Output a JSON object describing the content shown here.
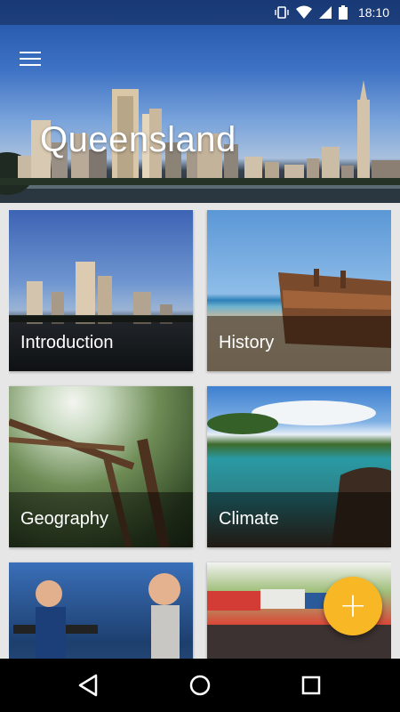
{
  "status_bar": {
    "time": "18:10",
    "icons": [
      "vibrate-icon",
      "wifi-icon",
      "signal-icon",
      "battery-icon"
    ]
  },
  "header": {
    "title": "Queensland",
    "menu_icon": "hamburger-menu-icon"
  },
  "cards": [
    {
      "label": "Introduction"
    },
    {
      "label": "History"
    },
    {
      "label": "Geography"
    },
    {
      "label": "Climate"
    },
    {
      "label": ""
    },
    {
      "label": ""
    }
  ],
  "fab": {
    "icon": "plus-icon",
    "label": "+",
    "color": "#f8b826"
  },
  "nav_bar": {
    "icons": [
      "back-icon",
      "home-icon",
      "recent-apps-icon"
    ]
  }
}
